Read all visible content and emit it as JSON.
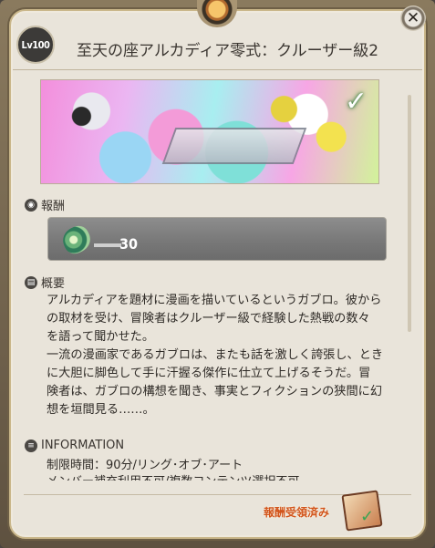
{
  "window": {
    "close_label": "✕",
    "level_badge": "Lv100",
    "title": "至天の座アルカディア零式：クルーザー級2"
  },
  "banner": {
    "cleared_mark": "✓"
  },
  "rewards": {
    "header": "報酬",
    "icon": "tomestone-icon",
    "quantity": "30"
  },
  "overview": {
    "header": "概要",
    "text_lines": [
      "アルカディアを題材に漫画を描いているというガブロ。彼から",
      "の取材を受け、冒険者はクルーザー級で経験した熱戦の数々",
      "を語って聞かせた。",
      "一流の漫画家であるガブロは、またも話を激しく誇張し、とき",
      "に大胆に脚色して手に汗握る傑作に仕立て上げるそうだ。冒",
      "険者は、ガブロの構想を聞き、事実とフィクションの狭間に幻",
      "想を垣間見る……。"
    ]
  },
  "information": {
    "header": "INFORMATION",
    "lines": [
      "制限時間：90分/リング･オブ･アート",
      "メンバー補充利用不可/複数コンテンツ選択不可"
    ]
  },
  "footer": {
    "claimed_label": "報酬受領済み"
  },
  "colors": {
    "panel_bg": "#e9e4da",
    "frame_gold": "#c9b68a",
    "claimed_text": "#d2541b",
    "reward_box": "#7f7f7f"
  }
}
